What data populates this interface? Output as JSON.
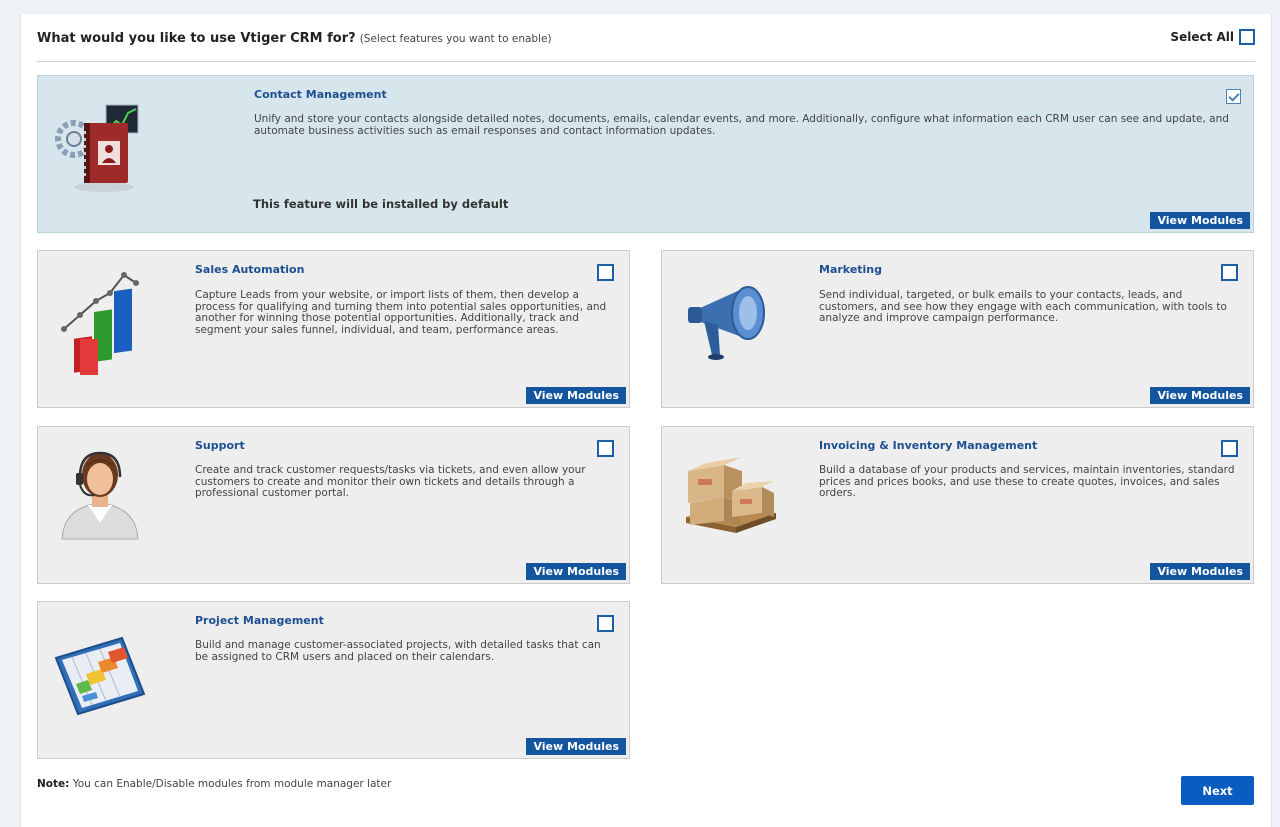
{
  "header": {
    "title": "What would you like to use Vtiger CRM for?",
    "subtitle": "(Select features you want to enable)",
    "select_all_label": "Select All"
  },
  "features": [
    {
      "title": "Contact Management",
      "description": "Unify and store your contacts alongside detailed notes, documents, emails, calendar events, and more. Additionally, configure what information each CRM user can see and update, and automate business activities such as email responses and contact information updates.",
      "default_note": "This feature will be installed by default",
      "checked": true,
      "icon": "contact-book-icon"
    },
    {
      "title": "Sales Automation",
      "description": "Capture Leads from your website, or import lists of them, then develop a process for qualifying and turning them into potential sales opportunities, and another for winning those potential opportunities. Additionally, track and segment your sales funnel, individual, and team, performance areas.",
      "checked": false,
      "icon": "bar-chart-icon"
    },
    {
      "title": "Marketing",
      "description": "Send individual, targeted, or bulk emails to your contacts, leads, and customers, and see how they engage with each communication, with tools to analyze and improve campaign performance.",
      "checked": false,
      "icon": "megaphone-icon"
    },
    {
      "title": "Support",
      "description": "Create and track customer requests/tasks via tickets, and even allow your customers to create and monitor their own tickets and details through a professional customer portal.",
      "checked": false,
      "icon": "support-agent-icon"
    },
    {
      "title": "Invoicing & Inventory Management",
      "description": "Build a database of your products and services, maintain inventories, standard prices and prices books, and use these to create quotes, invoices, and sales orders.",
      "checked": false,
      "icon": "boxes-pallet-icon"
    },
    {
      "title": "Project Management",
      "description": "Build and manage customer-associated projects, with detailed tasks that can be assigned to CRM users and placed on their calendars.",
      "checked": false,
      "icon": "gantt-chart-icon"
    }
  ],
  "view_modules_label": "View Modules",
  "footer": {
    "note_label": "Note:",
    "note_text": "You can Enable/Disable modules from module manager later",
    "next_label": "Next"
  },
  "colors": {
    "title_blue": "#1d4f91",
    "button_blue": "#13559e",
    "next_blue": "#0b5cc1",
    "featured_bg": "#d6e6ec"
  }
}
